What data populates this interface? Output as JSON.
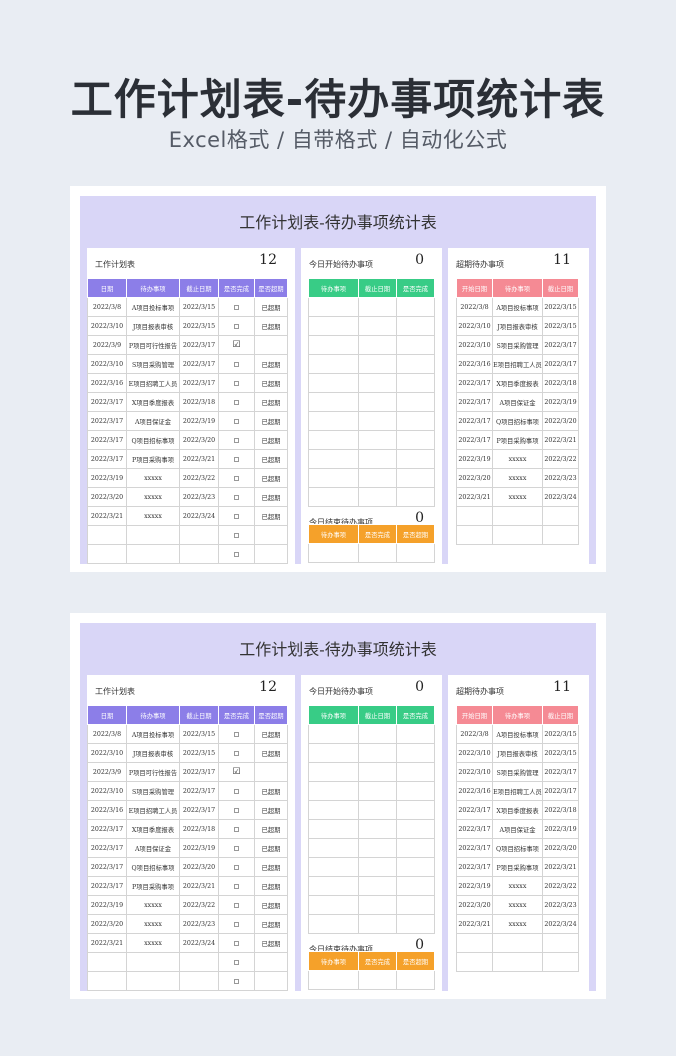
{
  "page": {
    "title": "工作计划表-待办事项统计表",
    "subtitle": "Excel格式 / 自带格式 / 自动化公式"
  },
  "sheet": {
    "title": "工作计划表-待办事项统计表",
    "left": {
      "label": "工作计划表",
      "count": "12",
      "headers": [
        "日期",
        "待办事项",
        "截止日期",
        "是否完成",
        "是否超期"
      ],
      "rows": [
        [
          "2022/3/8",
          "A项目投标事项",
          "2022/3/15",
          "empty",
          "已超期"
        ],
        [
          "2022/3/10",
          "J项目报表审核",
          "2022/3/15",
          "empty",
          "已超期"
        ],
        [
          "2022/3/9",
          "P项目可行性报告",
          "2022/3/17",
          "checked",
          ""
        ],
        [
          "2022/3/10",
          "S项目采购管理",
          "2022/3/17",
          "empty",
          "已超期"
        ],
        [
          "2022/3/16",
          "E项目招聘工人员",
          "2022/3/17",
          "empty",
          "已超期"
        ],
        [
          "2022/3/17",
          "X项目季度报表",
          "2022/3/18",
          "empty",
          "已超期"
        ],
        [
          "2022/3/17",
          "A项目保证金",
          "2022/3/19",
          "empty",
          "已超期"
        ],
        [
          "2022/3/17",
          "Q项目招标事项",
          "2022/3/20",
          "empty",
          "已超期"
        ],
        [
          "2022/3/17",
          "P项目采购事项",
          "2022/3/21",
          "empty",
          "已超期"
        ],
        [
          "2022/3/19",
          "xxxxx",
          "2022/3/22",
          "empty",
          "已超期"
        ],
        [
          "2022/3/20",
          "xxxxx",
          "2022/3/23",
          "empty",
          "已超期"
        ],
        [
          "2022/3/21",
          "xxxxx",
          "2022/3/24",
          "empty",
          "已超期"
        ],
        [
          "",
          "",
          "",
          "empty",
          ""
        ],
        [
          "",
          "",
          "",
          "empty",
          ""
        ]
      ]
    },
    "mid_top": {
      "label": "今日开始待办事项",
      "count": "0",
      "headers": [
        "待办事项",
        "截止日期",
        "是否完成"
      ]
    },
    "mid_bottom": {
      "label": "今日结束待办事项",
      "count": "0",
      "headers": [
        "待办事项",
        "是否完成",
        "是否超期"
      ]
    },
    "right": {
      "label": "超期待办事项",
      "count": "11",
      "headers": [
        "开始日期",
        "待办事项",
        "截止日期"
      ],
      "rows": [
        [
          "2022/3/8",
          "A项目投标事项",
          "2022/3/15"
        ],
        [
          "2022/3/10",
          "J项目报表审核",
          "2022/3/15"
        ],
        [
          "2022/3/10",
          "S项目采购管理",
          "2022/3/17"
        ],
        [
          "2022/3/16",
          "E项目招聘工人员",
          "2022/3/17"
        ],
        [
          "2022/3/17",
          "X项目季度报表",
          "2022/3/18"
        ],
        [
          "2022/3/17",
          "A项目保证金",
          "2022/3/19"
        ],
        [
          "2022/3/17",
          "Q项目招标事项",
          "2022/3/20"
        ],
        [
          "2022/3/17",
          "P项目采购事项",
          "2022/3/21"
        ],
        [
          "2022/3/19",
          "xxxxx",
          "2022/3/22"
        ],
        [
          "2022/3/20",
          "xxxxx",
          "2022/3/23"
        ],
        [
          "2022/3/21",
          "xxxxx",
          "2022/3/24"
        ],
        [
          "",
          "",
          ""
        ],
        [
          "",
          "",
          ""
        ]
      ]
    }
  }
}
